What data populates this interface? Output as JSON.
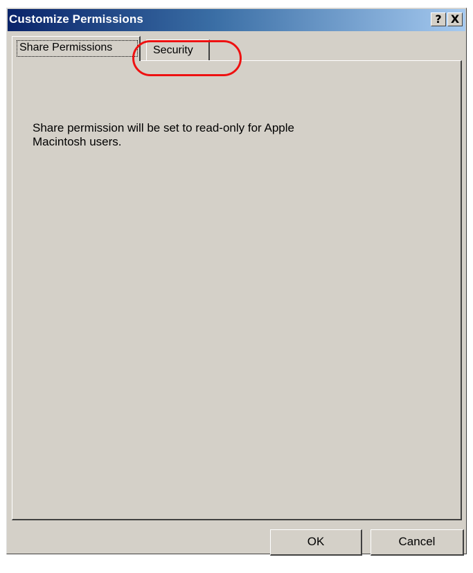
{
  "window": {
    "title": "Customize Permissions",
    "help_glyph": "?",
    "close_glyph": "X"
  },
  "tabs": [
    {
      "label": "Share Permissions",
      "selected": true
    },
    {
      "label": "Security",
      "selected": false
    }
  ],
  "panel": {
    "message": "Share permission will be set to read-only for Apple Macintosh users."
  },
  "buttons": {
    "ok_label": "OK",
    "cancel_label": "Cancel"
  },
  "colors": {
    "titlebar_start": "#0a246a",
    "titlebar_end": "#a6caf0",
    "dialog_face": "#d4d0c8",
    "annotation": "#ee1111"
  },
  "icons": {
    "help": "help-icon",
    "close": "close-icon"
  }
}
